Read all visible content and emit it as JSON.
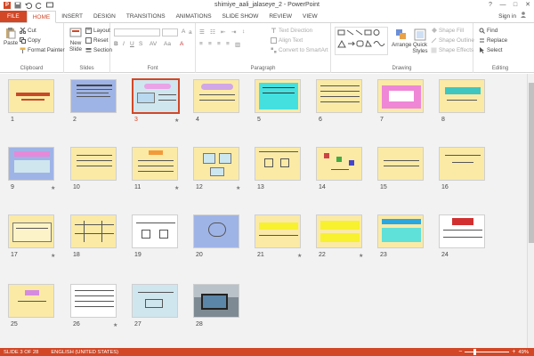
{
  "window": {
    "title": "shimiye_aali_jalaseye_2 - PowerPoint",
    "minimize": "—",
    "maximize": "□",
    "close": "✕",
    "help": "?"
  },
  "tabs": [
    {
      "label": "FILE"
    },
    {
      "label": "HOME"
    },
    {
      "label": "INSERT"
    },
    {
      "label": "DESIGN"
    },
    {
      "label": "TRANSITIONS"
    },
    {
      "label": "ANIMATIONS"
    },
    {
      "label": "SLIDE SHOW"
    },
    {
      "label": "REVIEW"
    },
    {
      "label": "VIEW"
    }
  ],
  "active_tab": "HOME",
  "signin": "Sign in",
  "ribbon": {
    "clipboard": {
      "label": "Clipboard",
      "paste": "Paste",
      "cut": "Cut",
      "copy": "Copy",
      "format_painter": "Format Painter"
    },
    "slides": {
      "label": "Slides",
      "new_slide": "New Slide",
      "layout": "Layout",
      "reset": "Reset",
      "section": "Section"
    },
    "font": {
      "label": "Font"
    },
    "paragraph": {
      "label": "Paragraph",
      "text_direction": "Text Direction",
      "align_text": "Align Text",
      "convert_smartart": "Convert to SmartArt"
    },
    "drawing": {
      "label": "Drawing",
      "arrange": "Arrange",
      "quick_styles": "Quick Styles",
      "shape_fill": "Shape Fill",
      "shape_outline": "Shape Outline",
      "shape_effects": "Shape Effects"
    },
    "editing": {
      "label": "Editing",
      "find": "Find",
      "replace": "Replace",
      "select": "Select"
    }
  },
  "slides": [
    {
      "n": "1",
      "star": ""
    },
    {
      "n": "2",
      "star": ""
    },
    {
      "n": "3",
      "star": "★"
    },
    {
      "n": "4",
      "star": ""
    },
    {
      "n": "5",
      "star": ""
    },
    {
      "n": "6",
      "star": ""
    },
    {
      "n": "7",
      "star": ""
    },
    {
      "n": "8",
      "star": ""
    },
    {
      "n": "9",
      "star": "★"
    },
    {
      "n": "10",
      "star": ""
    },
    {
      "n": "11",
      "star": "★"
    },
    {
      "n": "12",
      "star": "★"
    },
    {
      "n": "13",
      "star": ""
    },
    {
      "n": "14",
      "star": ""
    },
    {
      "n": "15",
      "star": ""
    },
    {
      "n": "16",
      "star": ""
    },
    {
      "n": "17",
      "star": "★"
    },
    {
      "n": "18",
      "star": ""
    },
    {
      "n": "19",
      "star": ""
    },
    {
      "n": "20",
      "star": ""
    },
    {
      "n": "21",
      "star": "★"
    },
    {
      "n": "22",
      "star": "★"
    },
    {
      "n": "23",
      "star": ""
    },
    {
      "n": "24",
      "star": ""
    },
    {
      "n": "25",
      "star": ""
    },
    {
      "n": "26",
      "star": "★"
    },
    {
      "n": "27",
      "star": ""
    },
    {
      "n": "28",
      "star": ""
    }
  ],
  "selected_slide": "3",
  "status": {
    "slide_info": "SLIDE 3 OF 28",
    "language": "ENGLISH (UNITED STATES)",
    "zoom": "49%"
  }
}
